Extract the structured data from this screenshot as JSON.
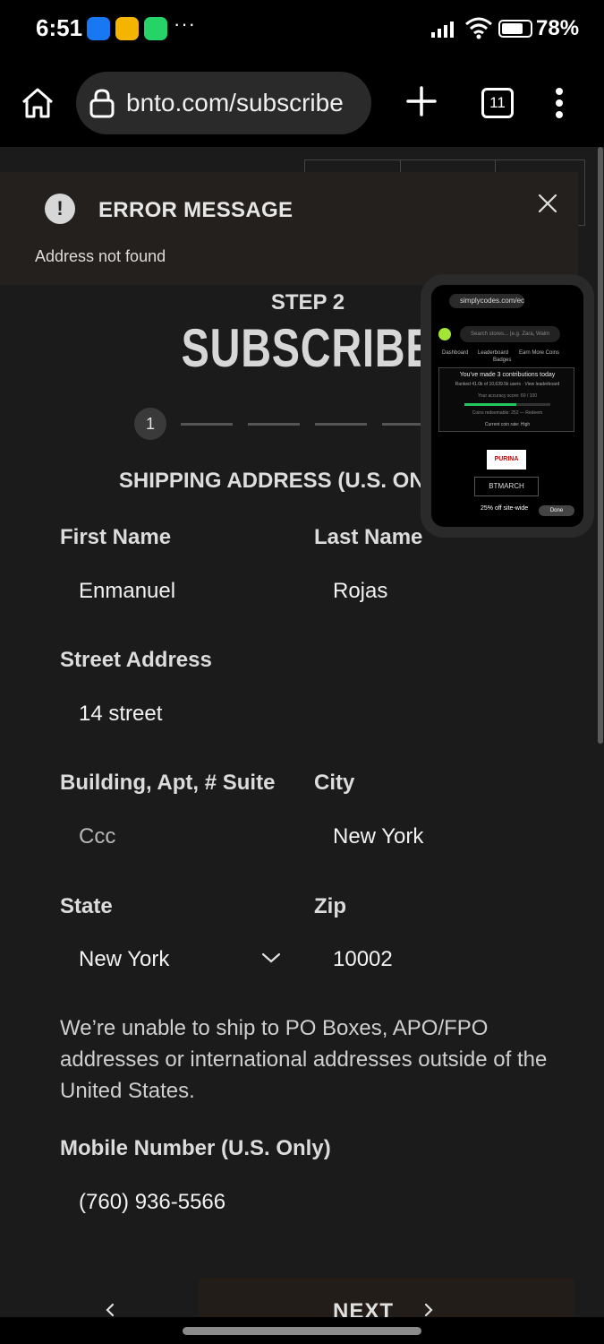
{
  "status_bar": {
    "time": "6:51",
    "more": "···",
    "battery": "78%",
    "battery_level": 0.78,
    "icons": [
      "facebook-icon",
      "download-icon",
      "whatsapp-icon",
      "signal-icon",
      "wifi-icon",
      "battery-icon"
    ]
  },
  "browser": {
    "url": "bnto.com/subscribe",
    "tab_count": "11"
  },
  "error": {
    "title": "ERROR MESSAGE",
    "message": "Address not found",
    "icon": "!"
  },
  "header": {
    "step_label": "STEP 2",
    "title": "SUBSCRIBE"
  },
  "stepper": {
    "current": "1"
  },
  "form": {
    "section_title": "SHIPPING ADDRESS (U.S. ONLY)",
    "first_name_label": "First Name",
    "first_name_value": "Enmanuel",
    "last_name_label": "Last Name",
    "last_name_value": "Rojas",
    "street_label": "Street Address",
    "street_value": "14 street",
    "building_label": "Building, Apt, # Suite",
    "building_value": "Ccc",
    "city_label": "City",
    "city_value": "New York",
    "state_label": "State",
    "state_value": "New York",
    "zip_label": "Zip",
    "zip_value": "10002",
    "notice": "We’re unable to ship to PO Boxes, APO/FPO addresses or international addresses outside of the United States.",
    "mobile_label": "Mobile Number (U.S. Only)",
    "mobile_value": "(760) 936-5566"
  },
  "nav": {
    "next_label": "NEXT"
  },
  "pip": {
    "url": "simplycodes.com/ec",
    "search_placeholder": "Search stores... (e.g. Zara, Walm",
    "nav_dashboard": "Dashboard",
    "nav_leaderboard": "Leaderboard",
    "nav_badges": "Badges",
    "nav_earn": "Earn More Coins",
    "card_title": "You've made 3 contributions today",
    "card_sub": "Ranked 41.0k of 10,639.5k users · View leaderboard",
    "card_score": "Your accuracy score: 60 / 100",
    "card_coins": "Coins redeemable: 252 — Redeem",
    "card_rate": "Current coin rate: High",
    "accuracy_fraction": 0.6,
    "brand": "PURINA",
    "code": "BTMARCH",
    "offer": "25% off site-wide",
    "done": "Done"
  }
}
